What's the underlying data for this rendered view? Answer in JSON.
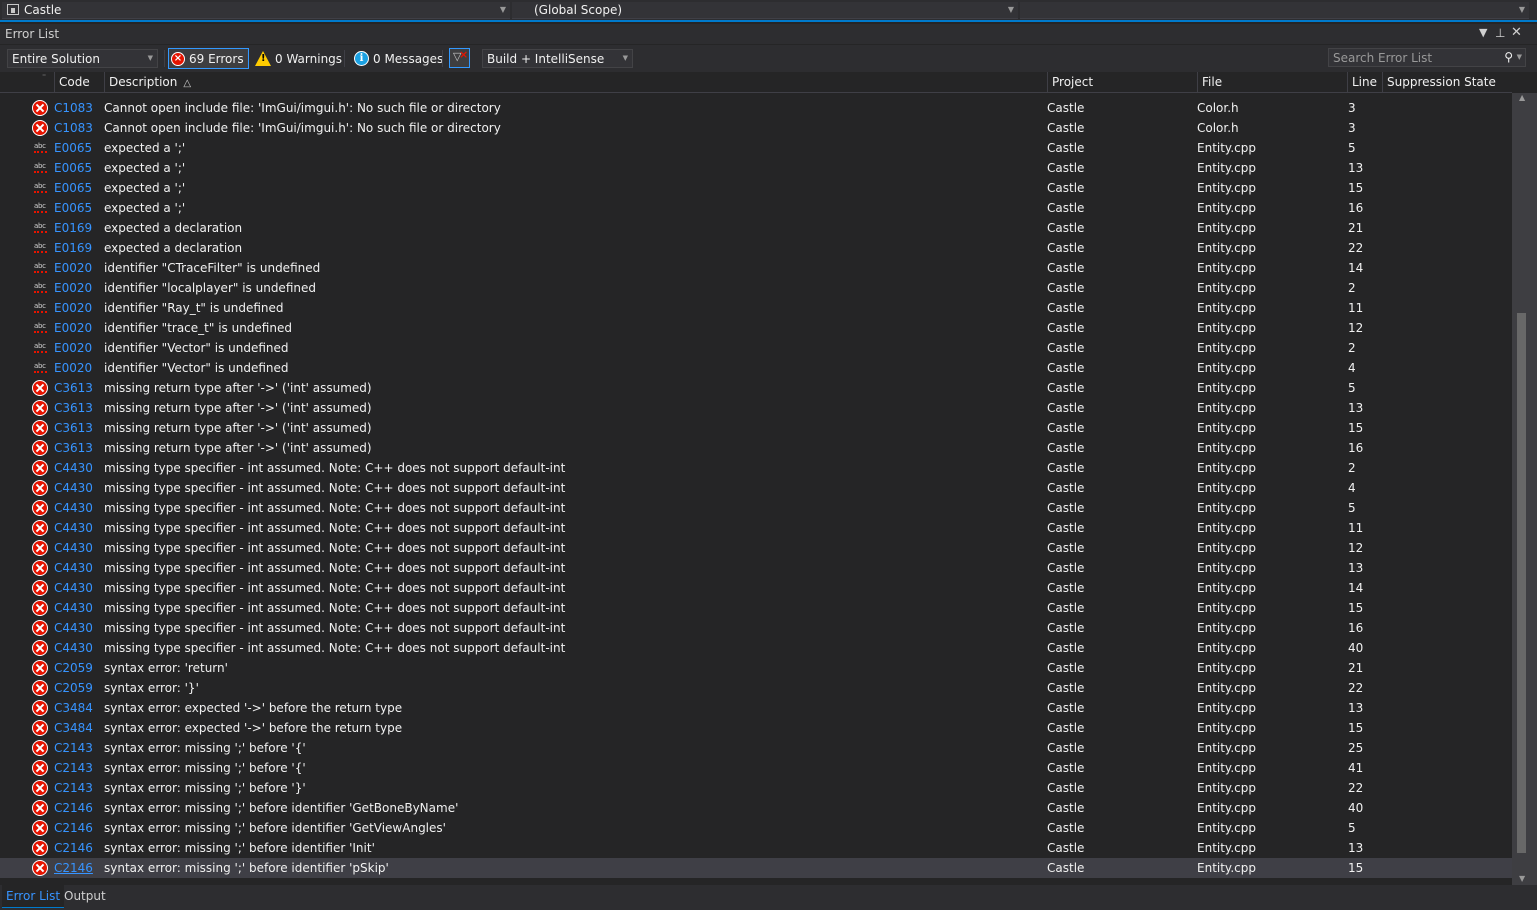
{
  "nav": {
    "project": "Castle",
    "scope": "(Global Scope)",
    "member": ""
  },
  "panel": {
    "title": "Error List"
  },
  "toolbar": {
    "scope_combo": "Entire Solution",
    "errors_label": "69 Errors",
    "warnings_label": "0 Warnings",
    "messages_label": "0 Messages",
    "build_combo": "Build + IntelliSense",
    "search_placeholder": "Search Error List"
  },
  "columns": {
    "code": "Code",
    "description": "Description",
    "project": "Project",
    "file": "File",
    "line": "Line",
    "suppression": "Suppression State"
  },
  "rows": [
    {
      "icon": "error",
      "code": "C1083",
      "description": "Cannot open include file: 'ImGui/imgui.h': No such file or directory",
      "project": "Castle",
      "file": "Color.h",
      "line": "3"
    },
    {
      "icon": "error",
      "code": "C1083",
      "description": "Cannot open include file: 'ImGui/imgui.h': No such file or directory",
      "project": "Castle",
      "file": "Color.h",
      "line": "3"
    },
    {
      "icon": "spell",
      "code": "E0065",
      "description": "expected a ';'",
      "project": "Castle",
      "file": "Entity.cpp",
      "line": "5"
    },
    {
      "icon": "spell",
      "code": "E0065",
      "description": "expected a ';'",
      "project": "Castle",
      "file": "Entity.cpp",
      "line": "13"
    },
    {
      "icon": "spell",
      "code": "E0065",
      "description": "expected a ';'",
      "project": "Castle",
      "file": "Entity.cpp",
      "line": "15"
    },
    {
      "icon": "spell",
      "code": "E0065",
      "description": "expected a ';'",
      "project": "Castle",
      "file": "Entity.cpp",
      "line": "16"
    },
    {
      "icon": "spell",
      "code": "E0169",
      "description": "expected a declaration",
      "project": "Castle",
      "file": "Entity.cpp",
      "line": "21"
    },
    {
      "icon": "spell",
      "code": "E0169",
      "description": "expected a declaration",
      "project": "Castle",
      "file": "Entity.cpp",
      "line": "22"
    },
    {
      "icon": "spell",
      "code": "E0020",
      "description": "identifier \"CTraceFilter\" is undefined",
      "project": "Castle",
      "file": "Entity.cpp",
      "line": "14"
    },
    {
      "icon": "spell",
      "code": "E0020",
      "description": "identifier \"localplayer\" is undefined",
      "project": "Castle",
      "file": "Entity.cpp",
      "line": "2"
    },
    {
      "icon": "spell",
      "code": "E0020",
      "description": "identifier \"Ray_t\" is undefined",
      "project": "Castle",
      "file": "Entity.cpp",
      "line": "11"
    },
    {
      "icon": "spell",
      "code": "E0020",
      "description": "identifier \"trace_t\" is undefined",
      "project": "Castle",
      "file": "Entity.cpp",
      "line": "12"
    },
    {
      "icon": "spell",
      "code": "E0020",
      "description": "identifier \"Vector\" is undefined",
      "project": "Castle",
      "file": "Entity.cpp",
      "line": "2"
    },
    {
      "icon": "spell",
      "code": "E0020",
      "description": "identifier \"Vector\" is undefined",
      "project": "Castle",
      "file": "Entity.cpp",
      "line": "4"
    },
    {
      "icon": "error",
      "code": "C3613",
      "description": "missing return type after '->' ('int' assumed)",
      "project": "Castle",
      "file": "Entity.cpp",
      "line": "5"
    },
    {
      "icon": "error",
      "code": "C3613",
      "description": "missing return type after '->' ('int' assumed)",
      "project": "Castle",
      "file": "Entity.cpp",
      "line": "13"
    },
    {
      "icon": "error",
      "code": "C3613",
      "description": "missing return type after '->' ('int' assumed)",
      "project": "Castle",
      "file": "Entity.cpp",
      "line": "15"
    },
    {
      "icon": "error",
      "code": "C3613",
      "description": "missing return type after '->' ('int' assumed)",
      "project": "Castle",
      "file": "Entity.cpp",
      "line": "16"
    },
    {
      "icon": "error",
      "code": "C4430",
      "description": "missing type specifier - int assumed. Note: C++ does not support default-int",
      "project": "Castle",
      "file": "Entity.cpp",
      "line": "2"
    },
    {
      "icon": "error",
      "code": "C4430",
      "description": "missing type specifier - int assumed. Note: C++ does not support default-int",
      "project": "Castle",
      "file": "Entity.cpp",
      "line": "4"
    },
    {
      "icon": "error",
      "code": "C4430",
      "description": "missing type specifier - int assumed. Note: C++ does not support default-int",
      "project": "Castle",
      "file": "Entity.cpp",
      "line": "5"
    },
    {
      "icon": "error",
      "code": "C4430",
      "description": "missing type specifier - int assumed. Note: C++ does not support default-int",
      "project": "Castle",
      "file": "Entity.cpp",
      "line": "11"
    },
    {
      "icon": "error",
      "code": "C4430",
      "description": "missing type specifier - int assumed. Note: C++ does not support default-int",
      "project": "Castle",
      "file": "Entity.cpp",
      "line": "12"
    },
    {
      "icon": "error",
      "code": "C4430",
      "description": "missing type specifier - int assumed. Note: C++ does not support default-int",
      "project": "Castle",
      "file": "Entity.cpp",
      "line": "13"
    },
    {
      "icon": "error",
      "code": "C4430",
      "description": "missing type specifier - int assumed. Note: C++ does not support default-int",
      "project": "Castle",
      "file": "Entity.cpp",
      "line": "14"
    },
    {
      "icon": "error",
      "code": "C4430",
      "description": "missing type specifier - int assumed. Note: C++ does not support default-int",
      "project": "Castle",
      "file": "Entity.cpp",
      "line": "15"
    },
    {
      "icon": "error",
      "code": "C4430",
      "description": "missing type specifier - int assumed. Note: C++ does not support default-int",
      "project": "Castle",
      "file": "Entity.cpp",
      "line": "16"
    },
    {
      "icon": "error",
      "code": "C4430",
      "description": "missing type specifier - int assumed. Note: C++ does not support default-int",
      "project": "Castle",
      "file": "Entity.cpp",
      "line": "40"
    },
    {
      "icon": "error",
      "code": "C2059",
      "description": "syntax error: 'return'",
      "project": "Castle",
      "file": "Entity.cpp",
      "line": "21"
    },
    {
      "icon": "error",
      "code": "C2059",
      "description": "syntax error: '}'",
      "project": "Castle",
      "file": "Entity.cpp",
      "line": "22"
    },
    {
      "icon": "error",
      "code": "C3484",
      "description": "syntax error: expected '->' before the return type",
      "project": "Castle",
      "file": "Entity.cpp",
      "line": "13"
    },
    {
      "icon": "error",
      "code": "C3484",
      "description": "syntax error: expected '->' before the return type",
      "project": "Castle",
      "file": "Entity.cpp",
      "line": "15"
    },
    {
      "icon": "error",
      "code": "C2143",
      "description": "syntax error: missing ';' before '{'",
      "project": "Castle",
      "file": "Entity.cpp",
      "line": "25"
    },
    {
      "icon": "error",
      "code": "C2143",
      "description": "syntax error: missing ';' before '{'",
      "project": "Castle",
      "file": "Entity.cpp",
      "line": "41"
    },
    {
      "icon": "error",
      "code": "C2143",
      "description": "syntax error: missing ';' before '}'",
      "project": "Castle",
      "file": "Entity.cpp",
      "line": "22"
    },
    {
      "icon": "error",
      "code": "C2146",
      "description": "syntax error: missing ';' before identifier 'GetBoneByName'",
      "project": "Castle",
      "file": "Entity.cpp",
      "line": "40"
    },
    {
      "icon": "error",
      "code": "C2146",
      "description": "syntax error: missing ';' before identifier 'GetViewAngles'",
      "project": "Castle",
      "file": "Entity.cpp",
      "line": "5"
    },
    {
      "icon": "error",
      "code": "C2146",
      "description": "syntax error: missing ';' before identifier 'Init'",
      "project": "Castle",
      "file": "Entity.cpp",
      "line": "13"
    },
    {
      "icon": "error",
      "code": "C2146",
      "description": "syntax error: missing ';' before identifier 'pSkip'",
      "project": "Castle",
      "file": "Entity.cpp",
      "line": "15",
      "selected": true
    }
  ],
  "tabs": {
    "error_list": "Error List",
    "output": "Output"
  },
  "colors": {
    "accent": "#007acc",
    "link": "#3794ff",
    "error": "#e51400",
    "warning": "#ffcc00",
    "info": "#1ba1e2"
  }
}
